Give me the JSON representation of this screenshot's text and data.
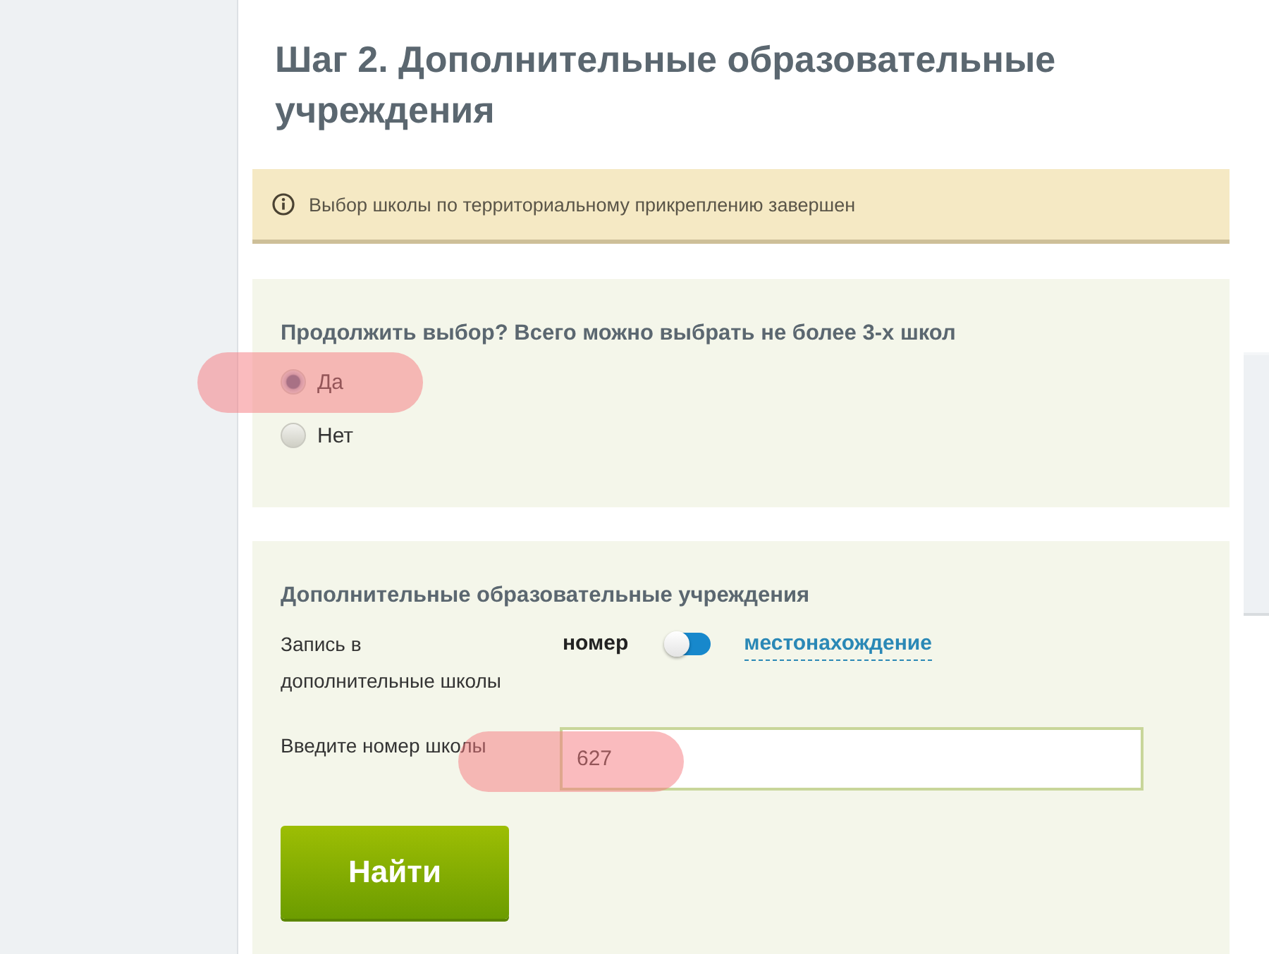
{
  "page": {
    "title": "Шаг 2. Дополнительные образовательные учреждения"
  },
  "notice": {
    "text": "Выбор школы по территориальному прикреплению завершен"
  },
  "continue_panel": {
    "question": "Продолжить выбор? Всего можно выбрать не более 3-х школ",
    "options": [
      {
        "label": "Да",
        "selected": true,
        "highlighted": true
      },
      {
        "label": "Нет",
        "selected": false,
        "highlighted": false
      }
    ]
  },
  "search_panel": {
    "heading": "Дополнительные образовательные учреждения",
    "mode": {
      "label": "Запись в дополнительные школы",
      "left_option": "номер",
      "toggle_on": false,
      "right_option": "местонахождение"
    },
    "school_number": {
      "label": "Введите номер школы",
      "value": "627",
      "highlighted": true
    },
    "button": "Найти"
  }
}
